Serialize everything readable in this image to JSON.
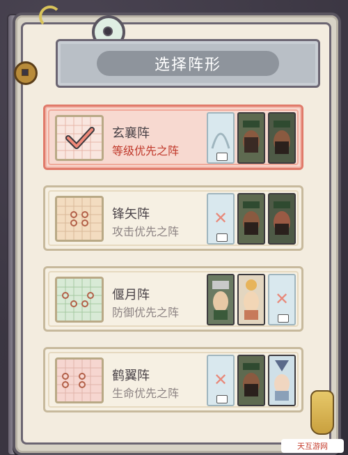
{
  "title": "选择阵形",
  "watermark": "天互游网",
  "formations": [
    {
      "name": "玄襄阵",
      "subtitle": "等级优先之阵",
      "selected": true,
      "grid_color": "#f7d9d0",
      "dot_color": "#e07a6a",
      "heroes": [
        "empty",
        "filled-green",
        "filled-dark"
      ]
    },
    {
      "name": "锋矢阵",
      "subtitle": "攻击优先之阵",
      "selected": false,
      "grid_color": "#f3dcc0",
      "dot_color": "#c0705a",
      "heroes": [
        "empty-x",
        "filled-green",
        "filled-dark"
      ]
    },
    {
      "name": "偃月阵",
      "subtitle": "防御优先之阵",
      "selected": false,
      "grid_color": "#d8ead6",
      "dot_color": "#c0705a",
      "heroes": [
        "filled-green",
        "filled-light",
        "empty-x"
      ]
    },
    {
      "name": "鹤翼阵",
      "subtitle": "生命优先之阵",
      "selected": false,
      "grid_color": "#f6d6d0",
      "dot_color": "#c0705a",
      "heroes": [
        "empty-x",
        "filled-green",
        "filled-light"
      ]
    }
  ]
}
